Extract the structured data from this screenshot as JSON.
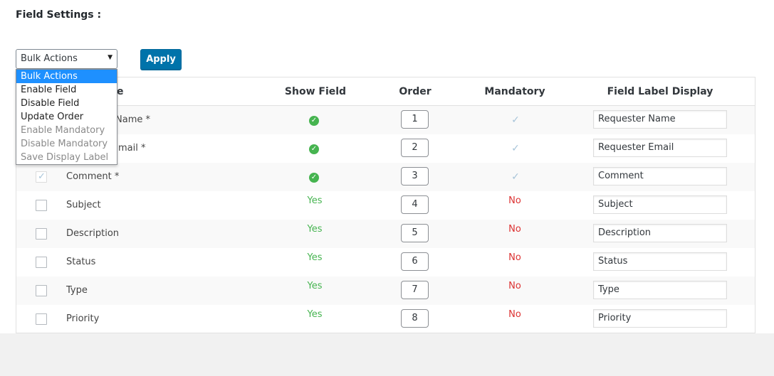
{
  "section_title": "Field Settings :",
  "bulk_select": {
    "value": "Bulk Actions"
  },
  "apply_label": "Apply",
  "dropdown": {
    "options": [
      {
        "label": "Bulk Actions",
        "state": "selected"
      },
      {
        "label": "Enable Field",
        "state": "enabled"
      },
      {
        "label": "Disable Field",
        "state": "enabled"
      },
      {
        "label": "Update Order",
        "state": "enabled"
      },
      {
        "label": "Enable Mandatory",
        "state": "disabled"
      },
      {
        "label": "Disable Mandatory",
        "state": "disabled"
      },
      {
        "label": "Save Display Label",
        "state": "disabled"
      }
    ]
  },
  "columns": {
    "field_name_partial": "e",
    "show_field": "Show Field",
    "order": "Order",
    "mandatory": "Mandatory",
    "field_label_display": "Field Label Display"
  },
  "rows": [
    {
      "name": "Name *",
      "name_visible": "Name *",
      "checked": true,
      "show": "icon",
      "order": "1",
      "mandatory": "check",
      "label": "Requester Name"
    },
    {
      "name": "Email *",
      "name_visible": "mail *",
      "checked": true,
      "show": "icon",
      "order": "2",
      "mandatory": "check",
      "label": "Requester Email"
    },
    {
      "name": "Comment *",
      "name_visible": "Comment *",
      "checked": true,
      "show": "icon",
      "order": "3",
      "mandatory": "check",
      "label": "Comment"
    },
    {
      "name": "Subject",
      "name_visible": "Subject",
      "checked": false,
      "show": "Yes",
      "order": "4",
      "mandatory": "No",
      "label": "Subject"
    },
    {
      "name": "Description",
      "name_visible": "Description",
      "checked": false,
      "show": "Yes",
      "order": "5",
      "mandatory": "No",
      "label": "Description"
    },
    {
      "name": "Status",
      "name_visible": "Status",
      "checked": false,
      "show": "Yes",
      "order": "6",
      "mandatory": "No",
      "label": "Status"
    },
    {
      "name": "Type",
      "name_visible": "Type",
      "checked": false,
      "show": "Yes",
      "order": "7",
      "mandatory": "No",
      "label": "Type"
    },
    {
      "name": "Priority",
      "name_visible": "Priority",
      "checked": false,
      "show": "Yes",
      "order": "8",
      "mandatory": "No",
      "label": "Priority"
    }
  ],
  "colors": {
    "apply_bg": "#0073aa",
    "yes": "#46b450",
    "no": "#dc3232",
    "dropdown_selected": "#1e90ff"
  }
}
